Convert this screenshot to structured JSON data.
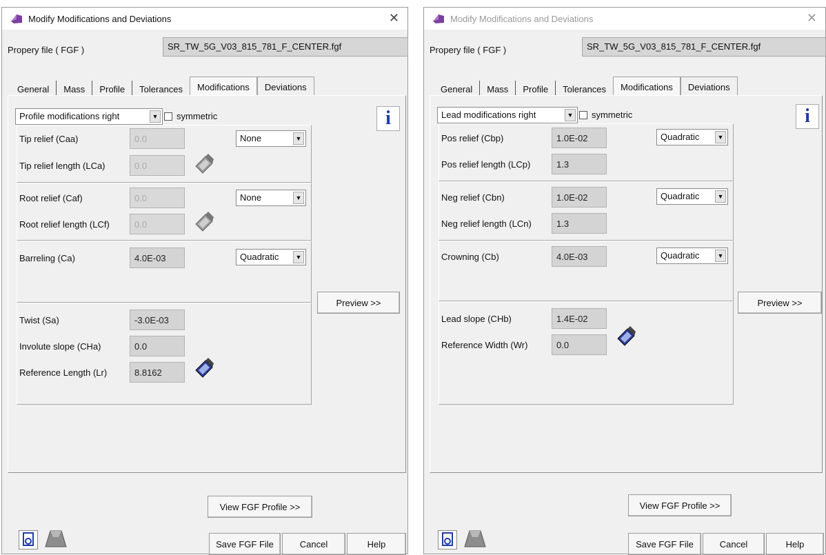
{
  "left": {
    "title": "Modify Modifications and Deviations",
    "prop_label": "Propery file ( FGF )",
    "prop_file": "SR_TW_5G_V03_815_781_F_CENTER.fgf",
    "tabs": [
      "General",
      "Mass",
      "Profile",
      "Tolerances",
      "Modifications",
      "Deviations"
    ],
    "active_tab": "Modifications",
    "mode_combo": "Profile modifications right",
    "symmetric": "symmetric",
    "info": "i",
    "fields": [
      {
        "label": "Tip relief (Caa)",
        "value": "0.0"
      },
      {
        "label": "Tip relief length (LCa)",
        "value": "0.0"
      },
      {
        "label": "Root relief (Caf)",
        "value": "0.0"
      },
      {
        "label": "Root relief length (LCf)",
        "value": "0.0"
      },
      {
        "label": "Barreling (Ca)",
        "value": "4.0E-03"
      },
      {
        "label": "Twist (Sa)",
        "value": "-3.0E-03"
      },
      {
        "label": "Involute slope (CHa)",
        "value": "0.0"
      },
      {
        "label": "Reference Length (Lr)",
        "value": "8.8162"
      }
    ],
    "combos": [
      "None",
      "None",
      "Quadratic"
    ],
    "preview": "Preview >>",
    "view_fgf": "View FGF Profile >>",
    "save": "Save FGF File",
    "cancel": "Cancel",
    "help": "Help"
  },
  "right": {
    "title": "Modify Modifications and Deviations",
    "prop_label": "Propery file ( FGF )",
    "prop_file": "SR_TW_5G_V03_815_781_F_CENTER.fgf",
    "tabs": [
      "General",
      "Mass",
      "Profile",
      "Tolerances",
      "Modifications",
      "Deviations"
    ],
    "active_tab": "Modifications",
    "mode_combo": "Lead modifications right",
    "symmetric": "symmetric",
    "info": "i",
    "fields": [
      {
        "label": "Pos relief (Cbp)",
        "value": "1.0E-02"
      },
      {
        "label": "Pos relief length (LCp)",
        "value": "1.3"
      },
      {
        "label": "Neg relief (Cbn)",
        "value": "1.0E-02"
      },
      {
        "label": "Neg relief length (LCn)",
        "value": "1.3"
      },
      {
        "label": "Crowning (Cb)",
        "value": "4.0E-03"
      },
      {
        "label": "Lead slope (CHb)",
        "value": "1.4E-02"
      },
      {
        "label": "Reference Width (Wr)",
        "value": "0.0"
      }
    ],
    "combos": [
      "Quadratic",
      "Quadratic",
      "Quadratic"
    ],
    "preview": "Preview >>",
    "view_fgf": "View FGF Profile >>",
    "save": "Save FGF File",
    "cancel": "Cancel",
    "help": "Help"
  }
}
